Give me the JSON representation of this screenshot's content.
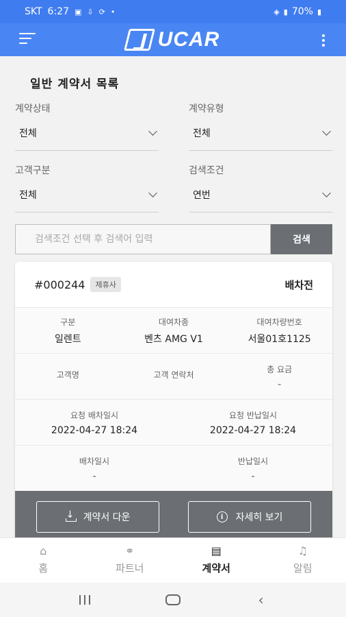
{
  "status_bar": {
    "carrier": "SKT",
    "time": "6:27",
    "battery": "70%"
  },
  "app_bar": {
    "logo_text": "UCAR",
    "accent_color": "#4a86f3"
  },
  "page": {
    "title": "일반 계약서 목록"
  },
  "filters": {
    "contract_status": {
      "label": "계약상태",
      "value": "전체"
    },
    "contract_type": {
      "label": "계약유형",
      "value": "전체"
    },
    "customer_type": {
      "label": "고객구분",
      "value": "전체"
    },
    "search_condition": {
      "label": "검색조건",
      "value": "연번"
    }
  },
  "search": {
    "placeholder": "검색조건 선택 후 검색어 입력",
    "button_label": "검색"
  },
  "contract_card": {
    "number": "#000244",
    "badge": "제휴사",
    "status": "배차전",
    "rows": [
      [
        {
          "label": "구분",
          "value": "일렌트"
        },
        {
          "label": "대여차종",
          "value": "벤츠 AMG V1"
        },
        {
          "label": "대여차량번호",
          "value": "서울01호1125"
        }
      ],
      [
        {
          "label": "고객명",
          "value": ""
        },
        {
          "label": "고객 연락처",
          "value": ""
        },
        {
          "label": "총 요금",
          "value": "-"
        }
      ],
      [
        {
          "label": "요청 배차일시",
          "value": "2022-04-27 18:24"
        },
        {
          "label": "요청 반납일시",
          "value": "2022-04-27 18:24"
        }
      ],
      [
        {
          "label": "배차일시",
          "value": "-"
        },
        {
          "label": "반납일시",
          "value": "-"
        }
      ]
    ],
    "download_label": "계약서 다운",
    "detail_label": "자세히 보기"
  },
  "bottom_nav": {
    "items": [
      {
        "label": "홈",
        "icon": "home-icon"
      },
      {
        "label": "파트너",
        "icon": "handshake-icon"
      },
      {
        "label": "계약서",
        "icon": "document-icon",
        "active": true
      },
      {
        "label": "알림",
        "icon": "bell-icon"
      }
    ]
  }
}
